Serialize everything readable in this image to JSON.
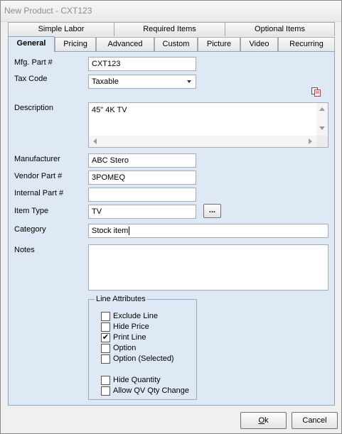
{
  "window": {
    "title": "New Product - CXT123"
  },
  "tabs_row1": [
    {
      "label": "Simple Labor"
    },
    {
      "label": "Required Items"
    },
    {
      "label": "Optional Items"
    }
  ],
  "tabs_row2": [
    {
      "label": "General"
    },
    {
      "label": "Pricing"
    },
    {
      "label": "Advanced"
    },
    {
      "label": "Custom"
    },
    {
      "label": "Picture"
    },
    {
      "label": "Video"
    },
    {
      "label": "Recurring"
    }
  ],
  "form": {
    "mfg_part_label": "Mfg. Part #",
    "mfg_part_value": "CXT123",
    "tax_code_label": "Tax Code",
    "tax_code_value": "Taxable",
    "description_label": "Description",
    "description_value": "45\" 4K TV",
    "manufacturer_label": "Manufacturer",
    "manufacturer_value": "ABC Stero",
    "vendor_part_label": "Vendor Part #",
    "vendor_part_value": "3POMEQ",
    "internal_part_label": "Internal Part #",
    "internal_part_value": "",
    "item_type_label": "Item Type",
    "item_type_value": "TV",
    "item_type_browse": "...",
    "category_label": "Category",
    "category_value": "Stock item",
    "notes_label": "Notes",
    "notes_value": ""
  },
  "line_attributes": {
    "title": "Line Attributes",
    "options": [
      {
        "label": "Exclude Line",
        "checked": false
      },
      {
        "label": "Hide Price",
        "checked": false
      },
      {
        "label": "Print Line",
        "checked": true
      },
      {
        "label": "Option",
        "checked": false
      },
      {
        "label": "Option (Selected)",
        "checked": false
      },
      {
        "label": "Hide Quantity",
        "checked": false
      },
      {
        "label": "Allow QV Qty Change",
        "checked": false
      }
    ]
  },
  "buttons": {
    "ok_hotkey": "O",
    "ok_rest": "k",
    "cancel_label": "Cancel"
  },
  "icons": {
    "copy_icon": "copy-icon"
  }
}
